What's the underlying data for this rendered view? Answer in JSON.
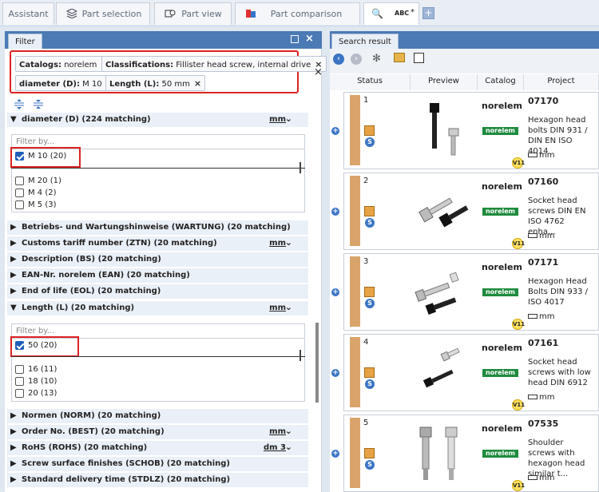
{
  "tabs": [
    {
      "label": "Assistant"
    },
    {
      "label": "Part selection"
    },
    {
      "label": "Part view"
    },
    {
      "label": "Part comparison"
    },
    {
      "label": "ABC"
    }
  ],
  "tab_search_suffix": "*",
  "filter_panel": {
    "title": "Filter",
    "chips": [
      {
        "key": "Catalogs:",
        "value": "norelem"
      },
      {
        "key": "Classifications:",
        "value": "Fillister head screw, internal drive"
      },
      {
        "key": "diameter (D):",
        "value": "M 10"
      },
      {
        "key": "Length (L):",
        "value": "50 mm"
      }
    ],
    "filter_placeholder": "Filter by...",
    "sections": [
      {
        "label": "diameter (D) (224 matching)",
        "unit": "mm",
        "expanded": true
      },
      {
        "label": "Betriebs- und Wartungshinweise (WARTUNG) (20 matching)",
        "unit": ""
      },
      {
        "label": "Customs tariff number (ZTN) (20 matching)",
        "unit": "mm"
      },
      {
        "label": "Description (BS) (20 matching)",
        "unit": ""
      },
      {
        "label": "EAN-Nr. norelem (EAN) (20 matching)",
        "unit": ""
      },
      {
        "label": "End of life (EOL) (20 matching)",
        "unit": ""
      },
      {
        "label": "Length (L) (20 matching)",
        "unit": "mm",
        "expanded": true
      },
      {
        "label": "Normen (NORM) (20 matching)",
        "unit": ""
      },
      {
        "label": "Order No. (BEST) (20 matching)",
        "unit": "mm"
      },
      {
        "label": "RoHS (ROHS) (20 matching)",
        "unit": "dm 3"
      },
      {
        "label": "Screw surface finishes (SCHOB) (20 matching)",
        "unit": ""
      },
      {
        "label": "Standard delivery time (STDLZ) (20 matching)",
        "unit": ""
      }
    ],
    "diameter_values": [
      {
        "label": "M 10 (20)",
        "checked": true
      },
      {
        "label": "M 20 (1)",
        "checked": false
      },
      {
        "label": "M 4 (2)",
        "checked": false
      },
      {
        "label": "M 5 (3)",
        "checked": false
      }
    ],
    "length_values": [
      {
        "label": "50 (20)",
        "checked": true
      },
      {
        "label": "16 (11)",
        "checked": false
      },
      {
        "label": "18 (10)",
        "checked": false
      },
      {
        "label": "20 (13)",
        "checked": false
      }
    ]
  },
  "results_panel": {
    "title": "Search result",
    "columns": [
      "Status",
      "Preview",
      "Catalog",
      "Project"
    ],
    "rows": [
      {
        "n": "1",
        "catalog": "norelem",
        "logo": "norelem",
        "id": "07170",
        "desc": "Hexagon head bolts DIN 931 / DIN EN ISO 4014",
        "unit": "mm",
        "badge": "V11",
        "status": "S"
      },
      {
        "n": "2",
        "catalog": "norelem",
        "logo": "norelem",
        "id": "07160",
        "desc": "Socket head screws DIN EN ISO 4762 enha...",
        "unit": "mm",
        "badge": "V11",
        "status": "S"
      },
      {
        "n": "3",
        "catalog": "norelem",
        "logo": "norelem",
        "id": "07171",
        "desc": "Hexagon Head Bolts DIN 933 / ISO 4017",
        "unit": "mm",
        "badge": "V11",
        "status": "S"
      },
      {
        "n": "4",
        "catalog": "norelem",
        "logo": "norelem",
        "id": "07161",
        "desc": "Socket head screws with low head DIN 6912",
        "unit": "mm",
        "badge": "V11",
        "status": "S"
      },
      {
        "n": "5",
        "catalog": "norelem",
        "logo": "norelem",
        "id": "07535",
        "desc": "Shoulder screws with hexagon head similar t...",
        "unit": "mm",
        "badge": "V11",
        "status": "S"
      }
    ]
  }
}
